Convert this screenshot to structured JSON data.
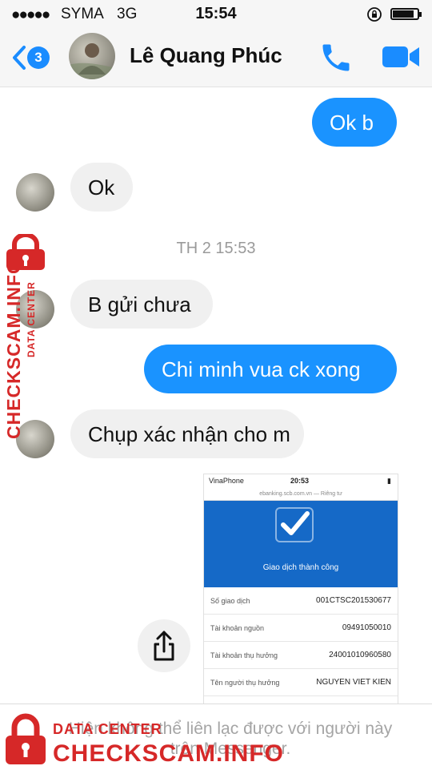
{
  "status_bar": {
    "signal": "●●●●●",
    "carrier": "SYMA",
    "network": "3G",
    "time": "15:54",
    "icons": [
      "orientation-lock-icon",
      "battery-icon"
    ]
  },
  "header": {
    "unread_count": "3",
    "contact_name": "Lê Quang Phúc",
    "icons": [
      "back-chevron-icon",
      "phone-icon",
      "video-camera-icon"
    ],
    "accent_color": "#1a8cff"
  },
  "messages": [
    {
      "direction": "outgoing",
      "text": "Ok b"
    },
    {
      "direction": "incoming",
      "text": "Ok"
    },
    {
      "direction": "incoming",
      "text": "B gửi chưa"
    },
    {
      "direction": "outgoing",
      "text": "Chi minh vua ck xong"
    },
    {
      "direction": "incoming",
      "text": "Chụp xác nhận cho m"
    }
  ],
  "timestamp_separator": "TH 2 15:53",
  "receipt_image": {
    "carrier": "VinaPhone",
    "time": "20:53",
    "url": "ebanking.scb.com.vn — Riêng tư",
    "banner_title": "Giao dịch thành công",
    "rows": [
      {
        "label": "Số giao dịch",
        "value": "001CTSC201530677"
      },
      {
        "label": "Tài khoản nguồn",
        "value": "09491050010"
      },
      {
        "label": "Tài khoản thụ hưởng",
        "value": "24001010960580"
      },
      {
        "label": "Tên người thụ hưởng",
        "value": "NGUYEN VIET KIEN"
      }
    ],
    "banner_color": "#1569c7"
  },
  "share_button": {
    "icon": "share-icon"
  },
  "footer": {
    "notice": "Hiện không thể liên lạc được với người này trên Messenger."
  },
  "watermark": {
    "brand": "CHECKSCAM.INFO",
    "subtitle": "DATA CENTER",
    "color": "#d62828",
    "icon": "padlock-icon"
  },
  "colors": {
    "outgoing_bubble": "#1a93ff",
    "incoming_bubble": "#f0f0f0"
  }
}
